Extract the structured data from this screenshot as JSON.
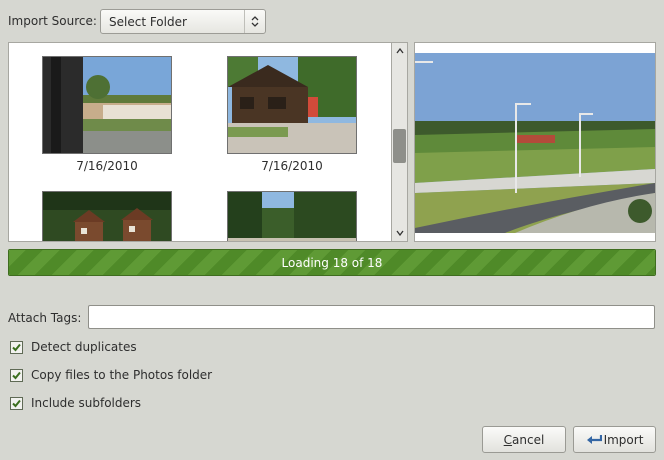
{
  "import_source": {
    "label": "Import Source:",
    "selected": "Select Folder"
  },
  "thumbnails": [
    {
      "date": "7/16/2010"
    },
    {
      "date": "7/16/2010"
    },
    {
      "date": ""
    },
    {
      "date": ""
    }
  ],
  "progress": {
    "text": "Loading 18 of 18",
    "fraction": 1.0
  },
  "tags": {
    "label": "Attach Tags:",
    "value": ""
  },
  "options": [
    {
      "label": "Detect duplicates",
      "checked": true
    },
    {
      "label": "Copy files to the Photos folder",
      "checked": true
    },
    {
      "label": "Include subfolders",
      "checked": true
    }
  ],
  "buttons": {
    "cancel_first": "C",
    "cancel_rest": "ancel",
    "import": "Import"
  },
  "colors": {
    "progress": "#5f9a35",
    "progress_border": "#3f6d1f"
  }
}
